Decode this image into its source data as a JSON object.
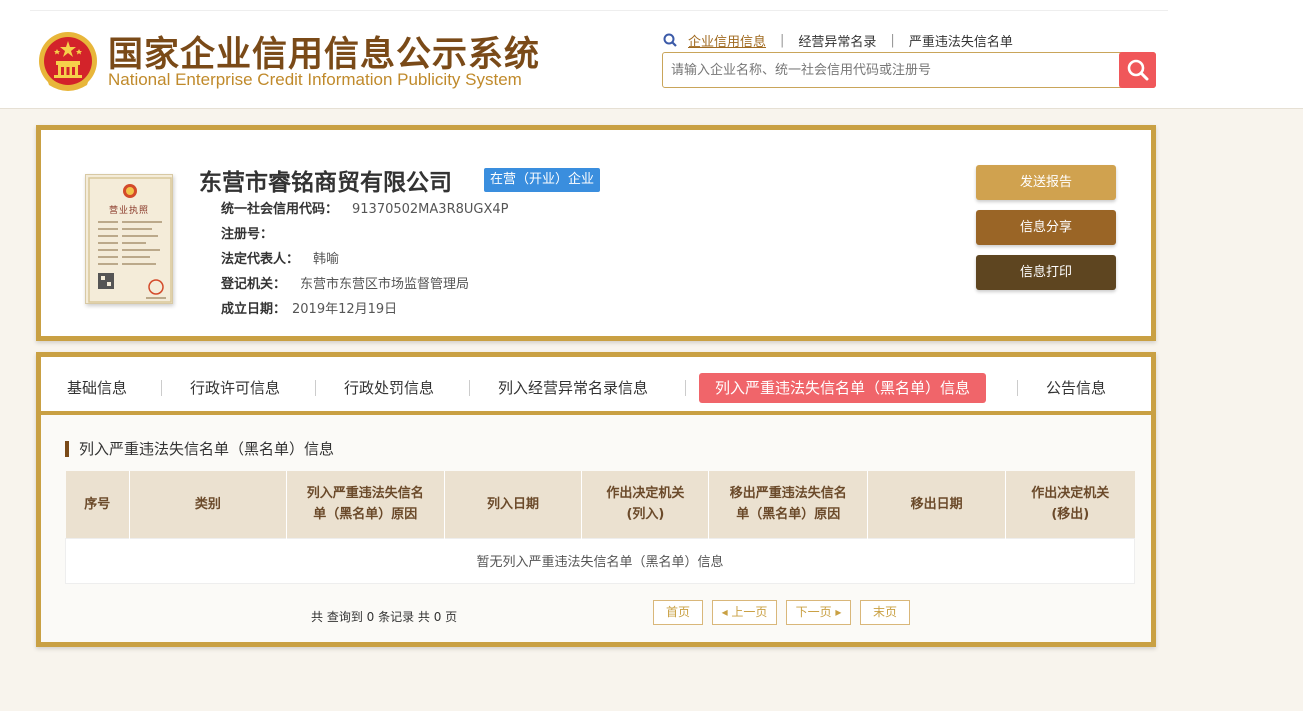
{
  "header": {
    "title_cn": "国家企业信用信息公示系统",
    "title_en": "National Enterprise Credit Information Publicity System",
    "links": [
      "企业信用信息",
      "经营异常名录",
      "严重违法失信名单"
    ],
    "search_placeholder": "请输入企业名称、统一社会信用代码或注册号"
  },
  "company": {
    "name": "东营市睿铭商贸有限公司",
    "status": "在营（开业）企业",
    "license_title": "营业执照",
    "fields": [
      {
        "label": "统一社会信用代码：",
        "value": "91370502MA3R8UGX4P"
      },
      {
        "label": "注册号：",
        "value": ""
      },
      {
        "label": "法定代表人：",
        "value": "韩喻"
      },
      {
        "label": "登记机关：",
        "value": "东营市东营区市场监督管理局"
      },
      {
        "label": "成立日期：",
        "value": "2019年12月19日"
      }
    ],
    "buttons": {
      "send": "发送报告",
      "share": "信息分享",
      "print": "信息打印"
    }
  },
  "tabs": [
    "基础信息",
    "行政许可信息",
    "行政处罚信息",
    "列入经营异常名录信息",
    "列入严重违法失信名单（黑名单）信息",
    "公告信息"
  ],
  "active_tab": 4,
  "section_title": "列入严重违法失信名单（黑名单）信息",
  "table": {
    "headers": [
      [
        "序号"
      ],
      [
        "类别"
      ],
      [
        "列入严重违法失信名",
        "单（黑名单）原因"
      ],
      [
        "列入日期"
      ],
      [
        "作出决定机关",
        "(列入)"
      ],
      [
        "移出严重违法失信名",
        "单（黑名单）原因"
      ],
      [
        "移出日期"
      ],
      [
        "作出决定机关",
        "(移出)"
      ]
    ],
    "empty_text": "暂无列入严重违法失信名单（黑名单）信息"
  },
  "pagination": {
    "summary": "共 查询到 0 条记录 共 0 页",
    "first": "首页",
    "prev": "◂ 上一页",
    "next": "下一页 ▸",
    "last": "末页"
  },
  "colors": {
    "gold": "#c9a043",
    "active_tab": "#f0656a",
    "badge": "#3a8ede",
    "search_btn": "#f0575a"
  }
}
